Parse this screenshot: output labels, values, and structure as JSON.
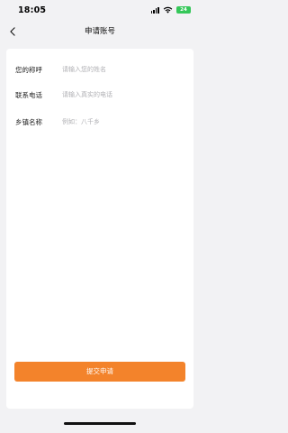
{
  "status_bar": {
    "time": "18:05",
    "battery": "24",
    "battery_color": "#35c759",
    "icons": [
      "signal-icon",
      "wifi-icon",
      "battery-icon"
    ]
  },
  "nav": {
    "back_icon": "chevron-left-icon",
    "title": "申请账号"
  },
  "form": {
    "fields": [
      {
        "label": "您的称呼",
        "placeholder": "请输入您的姓名",
        "value": ""
      },
      {
        "label": "联系电话",
        "placeholder": "请输入真实的电话",
        "value": ""
      },
      {
        "label": "乡镇名称",
        "placeholder": "例如：八千乡",
        "value": ""
      }
    ]
  },
  "submit": {
    "label": "提交申请",
    "color": "#f3832b"
  }
}
